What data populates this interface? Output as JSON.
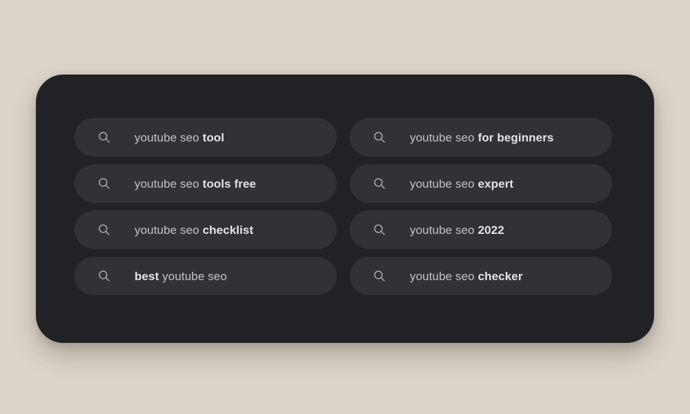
{
  "theme": {
    "canvas_background": "#dcd4c8",
    "card_background": "#212226",
    "pill_background": "#303236",
    "text_color": "#c2c5c9",
    "bold_text_color": "#e2e4e6",
    "icon_color": "#a8abaf"
  },
  "suggestions": {
    "icon_name": "search-icon",
    "items": [
      {
        "full_text": "youtube seo tool",
        "prefix": "youtube seo ",
        "bold": "tool",
        "suffix": "",
        "column": "left",
        "row": 1
      },
      {
        "full_text": "youtube seo for beginners",
        "prefix": "youtube seo ",
        "bold": "for beginners",
        "suffix": "",
        "column": "right",
        "row": 1
      },
      {
        "full_text": "youtube seo tools free",
        "prefix": "youtube seo ",
        "bold": "tools free",
        "suffix": "",
        "column": "left",
        "row": 2
      },
      {
        "full_text": "youtube seo expert",
        "prefix": "youtube seo ",
        "bold": "expert",
        "suffix": "",
        "column": "right",
        "row": 2
      },
      {
        "full_text": "youtube seo checklist",
        "prefix": "youtube seo ",
        "bold": "checklist",
        "suffix": "",
        "column": "left",
        "row": 3
      },
      {
        "full_text": "youtube seo 2022",
        "prefix": "youtube seo ",
        "bold": "2022",
        "suffix": "",
        "column": "right",
        "row": 3
      },
      {
        "full_text": "best youtube seo",
        "prefix": "",
        "bold": "best",
        "suffix": " youtube seo",
        "column": "left",
        "row": 4
      },
      {
        "full_text": "youtube seo checker",
        "prefix": "youtube seo ",
        "bold": "checker",
        "suffix": "",
        "column": "right",
        "row": 4
      }
    ]
  }
}
